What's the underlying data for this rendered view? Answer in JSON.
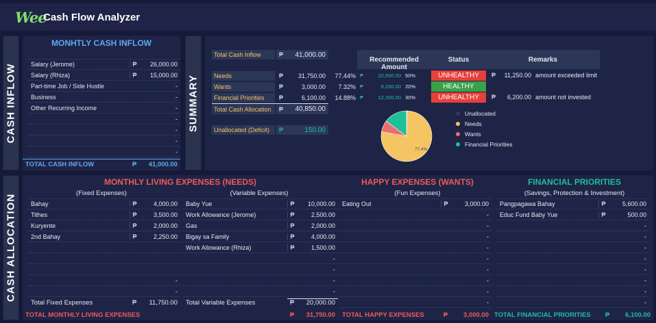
{
  "app": {
    "logo": "Wee",
    "title": "Cash Flow Analyzer"
  },
  "peso": "₱",
  "tabs": {
    "inflow": "CASH INFLOW",
    "summary": "SUMMARY",
    "allocation": "CASH ALLOCATION"
  },
  "inflow": {
    "title": "MONHTLY CASH INFLOW",
    "rows": [
      {
        "name": "Salary (Jerome)",
        "value": "26,000.00"
      },
      {
        "name": "Salary (Rhiza)",
        "value": "15,000.00"
      },
      {
        "name": "Part-time Job / Side Hustle",
        "value": "-"
      },
      {
        "name": "Business",
        "value": "-"
      },
      {
        "name": "Other Recurring Income",
        "value": "-"
      },
      {
        "name": "",
        "value": "-"
      },
      {
        "name": "",
        "value": "-"
      },
      {
        "name": "",
        "value": "-"
      },
      {
        "name": "",
        "value": "-"
      }
    ],
    "total_label": "TOTAL CASH INFLOW",
    "total_value": "41,000.00"
  },
  "summary": {
    "total_inflow_label": "Total Cash Inflow",
    "total_inflow_value": "41,000.00",
    "cat_rows": [
      {
        "name": "Needs",
        "value": "31,750.00",
        "pct": "77.44%"
      },
      {
        "name": "Wants",
        "value": "3,000.00",
        "pct": "7.32%"
      },
      {
        "name": "Financial Priorities",
        "value": "6,100.00",
        "pct": "14.88%"
      }
    ],
    "total_alloc_label": "Total Cash Allocation",
    "total_alloc_value": "40,850.00",
    "unalloc_label": "Unallocated (Deficit)",
    "unalloc_value": "150.00",
    "table_headers": {
      "recommended": "Recommended Amount",
      "status": "Status",
      "remarks": "Remarks"
    },
    "rec_rows": [
      {
        "amount": "20,500.00",
        "pct": "50%",
        "status": "UNHEALTHY",
        "remark_value": "11,250.00",
        "remark_text": "amount exceeded limit"
      },
      {
        "amount": "8,200.00",
        "pct": "20%",
        "status": "HEALTHY",
        "remark_value": "",
        "remark_text": ""
      },
      {
        "amount": "12,300.00",
        "pct": "30%",
        "status": "UNHEALTHY",
        "remark_value": "6,200.00",
        "remark_text": "amount not invested"
      }
    ],
    "colors": {
      "unhealthy": "#e5403a",
      "healthy": "#3aa04a"
    }
  },
  "chart_data": {
    "type": "pie",
    "categories": [
      "Unallocated",
      "Needs",
      "Wants",
      "Financial Priorities"
    ],
    "values": [
      0.37,
      77.44,
      7.32,
      14.88
    ],
    "colors": [
      "#2e3a55",
      "#f5c463",
      "#ec6d6d",
      "#1fbf9a"
    ],
    "data_label": "77.4%",
    "legend_position": "right"
  },
  "needs": {
    "title": "MONTHLY LIVING EXPENSES (NEEDS)",
    "fixed_sub": "(Fixed Expenses)",
    "variable_sub": "(Variable Expenses)",
    "fixed_rows": [
      {
        "name": "Bahay",
        "value": "4,000.00"
      },
      {
        "name": "Tithes",
        "value": "3,500.00"
      },
      {
        "name": "Kuryente",
        "value": "2,000.00"
      },
      {
        "name": "2nd Bahay",
        "value": "2,250.00"
      },
      {
        "name": "",
        "value": ""
      },
      {
        "name": "",
        "value": ""
      },
      {
        "name": "",
        "value": ""
      },
      {
        "name": "",
        "value": "-"
      },
      {
        "name": "",
        "value": "-"
      }
    ],
    "variable_rows": [
      {
        "name": "Baby Yue",
        "value": "10,000.00"
      },
      {
        "name": "Work Allowance  (Jerome)",
        "value": "2,500.00"
      },
      {
        "name": "Gas",
        "value": "2,000.00"
      },
      {
        "name": "Bigay sa Family",
        "value": "4,000.00"
      },
      {
        "name": "Work Allowance  (Rhiza)",
        "value": "1,500.00"
      },
      {
        "name": "",
        "value": "-"
      },
      {
        "name": "",
        "value": "-"
      },
      {
        "name": "",
        "value": "-"
      },
      {
        "name": "",
        "value": "-"
      }
    ],
    "fixed_total_label": "Total Fixed Expenses",
    "fixed_total_value": "11,750.00",
    "variable_total_label": "Total Variable Expenses",
    "variable_total_value": "20,000.00",
    "grand_label": "TOTAL MONTHLY LIVING EXPENSES",
    "grand_value": "31,750.00"
  },
  "wants": {
    "title": "HAPPY EXPENSES (WANTS)",
    "sub": "(Fun Expenses)",
    "rows": [
      {
        "name": "Eating Out",
        "value": "3,000.00"
      },
      {
        "name": "",
        "value": "-"
      },
      {
        "name": "",
        "value": "-"
      },
      {
        "name": "",
        "value": "-"
      },
      {
        "name": "",
        "value": "-"
      },
      {
        "name": "",
        "value": "-"
      },
      {
        "name": "",
        "value": "-"
      },
      {
        "name": "",
        "value": "-"
      },
      {
        "name": "",
        "value": "-"
      },
      {
        "name": "",
        "value": "-"
      }
    ],
    "total_label": "TOTAL HAPPY EXPENSES",
    "total_value": "3,000.00"
  },
  "priorities": {
    "title": "FINANCIAL PRIORITIES",
    "sub": "(Savings, Protection & Investment)",
    "rows": [
      {
        "name": "Pangpagawa Bahay",
        "value": "5,600.00"
      },
      {
        "name": "Educ Fund Baby Yue",
        "value": "500.00"
      },
      {
        "name": "",
        "value": "-"
      },
      {
        "name": "",
        "value": "-"
      },
      {
        "name": "",
        "value": "-"
      },
      {
        "name": "",
        "value": "-"
      },
      {
        "name": "",
        "value": "-"
      },
      {
        "name": "",
        "value": "-"
      },
      {
        "name": "",
        "value": "-"
      },
      {
        "name": "",
        "value": "-"
      }
    ],
    "total_label": "TOTAL FINANCIAL PRIORITIES",
    "total_value": "6,100.00"
  }
}
